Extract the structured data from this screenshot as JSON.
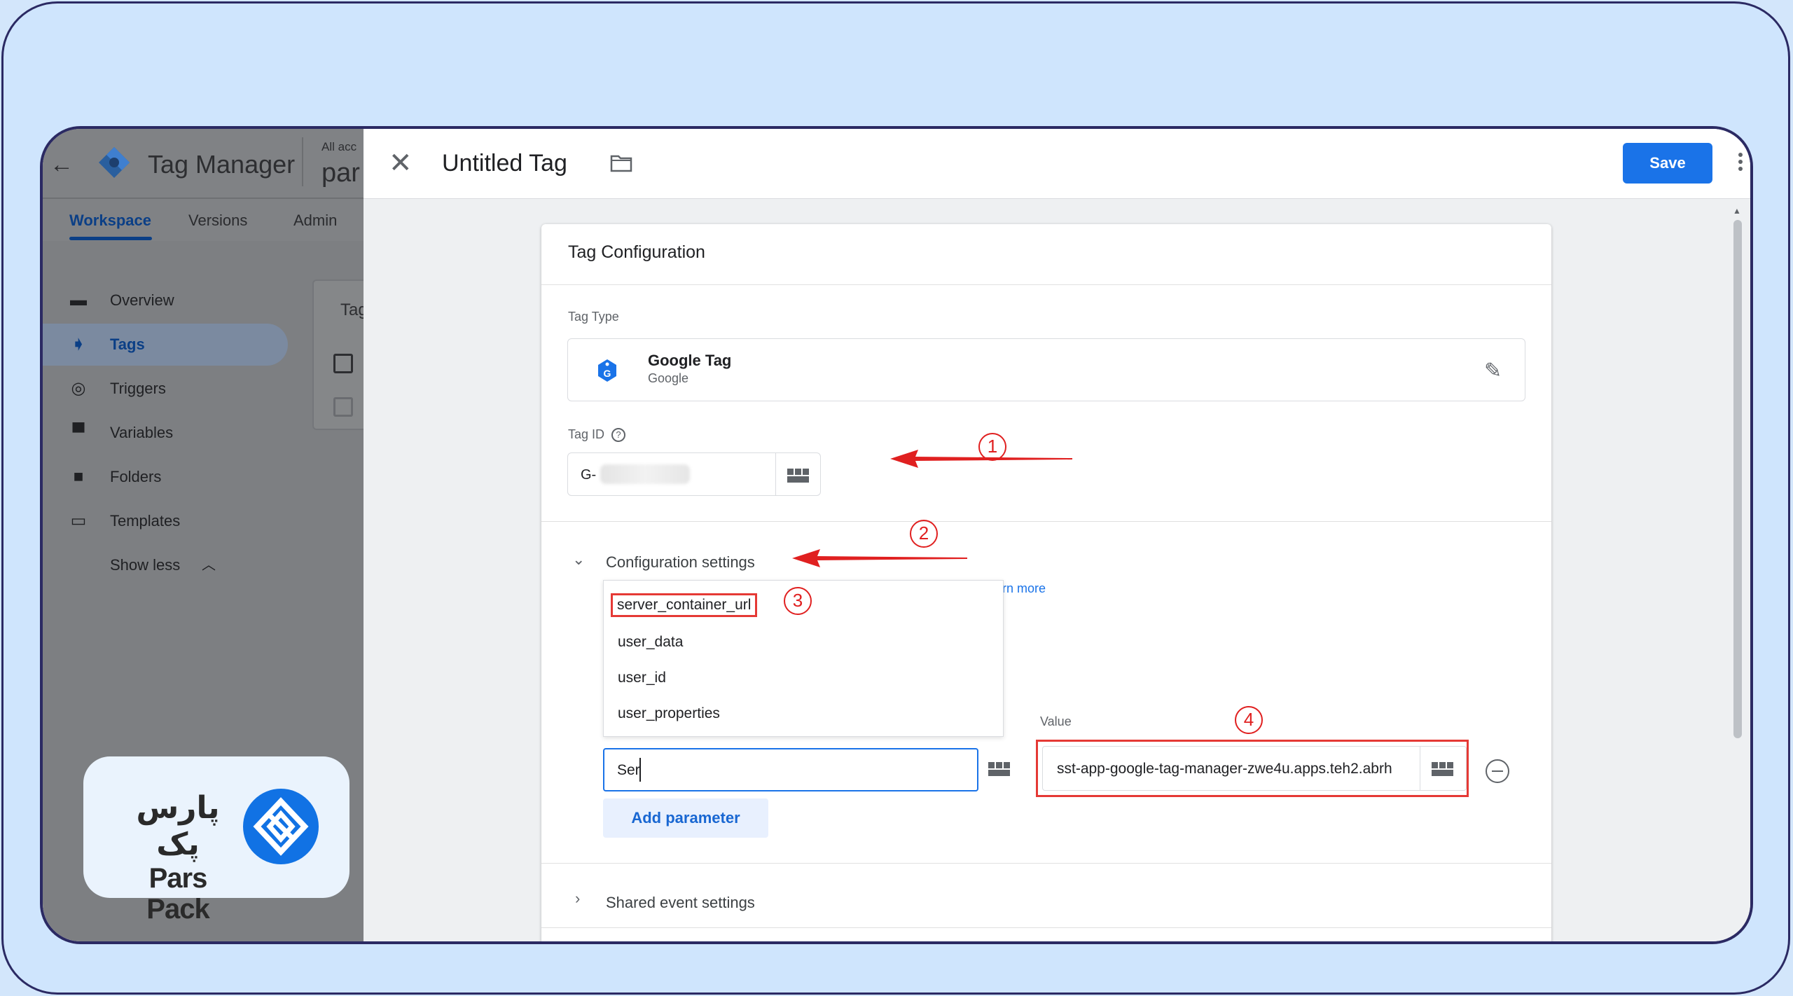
{
  "left_panel": {
    "app_title": "Tag Manager",
    "account_label": "All acc",
    "account_name": "par",
    "tabs": [
      {
        "label": "Workspace",
        "active": true
      },
      {
        "label": "Versions",
        "active": false
      },
      {
        "label": "Admin",
        "active": false
      }
    ],
    "nav": [
      {
        "label": "Overview",
        "icon": "overview-icon"
      },
      {
        "label": "Tags",
        "icon": "tag-icon",
        "selected": true
      },
      {
        "label": "Triggers",
        "icon": "trigger-icon"
      },
      {
        "label": "Variables",
        "icon": "variable-icon"
      },
      {
        "label": "Folders",
        "icon": "folder-icon"
      },
      {
        "label": "Templates",
        "icon": "template-icon"
      },
      {
        "label": "Show less",
        "icon": "chevron-up-icon"
      }
    ],
    "tags_card_title": "Tag"
  },
  "brand": {
    "name_fa": "پارس پک",
    "name_en": "Pars Pack"
  },
  "panel": {
    "title": "Untitled Tag",
    "save_label": "Save"
  },
  "config": {
    "card_title": "Tag Configuration",
    "tag_type_label": "Tag Type",
    "tag_type_name": "Google Tag",
    "tag_type_vendor": "Google",
    "tag_id_label": "Tag ID",
    "tag_id_value": "G-",
    "config_settings_label": "Configuration settings",
    "learn_more": "rn more",
    "dropdown_items": [
      "server_container_url",
      "user_data",
      "user_id",
      "user_properties"
    ],
    "param_input_value": "Ser",
    "value_label": "Value",
    "value_input": "sst-app-google-tag-manager-zwe4u.apps.teh2.abrh",
    "add_parameter_label": "Add parameter",
    "shared_event_label": "Shared event settings"
  },
  "annotations": {
    "markers": [
      "1",
      "2",
      "3",
      "4"
    ],
    "color": "#e02020"
  },
  "colors": {
    "accent": "#1a73e8",
    "frame_border": "#2b2a63",
    "background": "#cfe5fd"
  }
}
